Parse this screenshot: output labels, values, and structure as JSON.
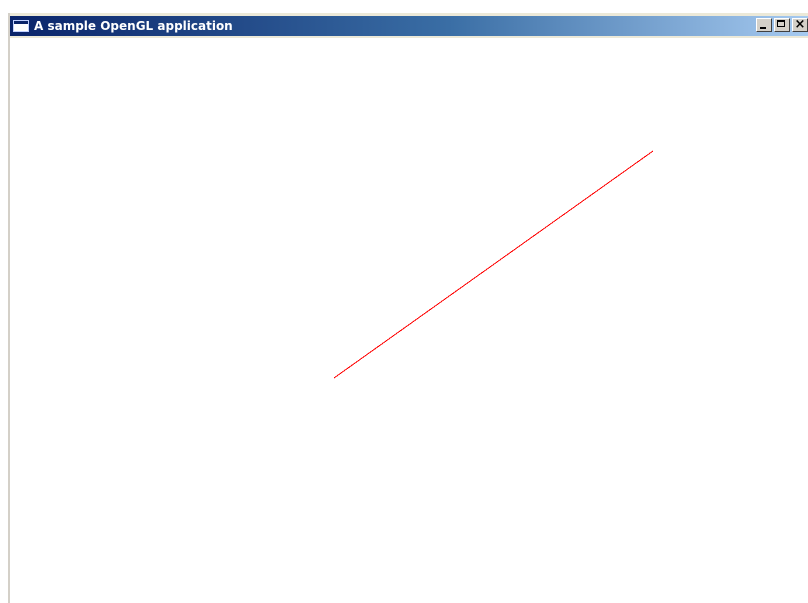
{
  "window": {
    "title": "A sample OpenGL application",
    "icon": "window-app-icon"
  },
  "controls": {
    "minimize_icon": "minimize-icon",
    "maximize_icon": "maximize-icon",
    "close_label": "×"
  },
  "canvas": {
    "background": "#ffffff",
    "line_color": "#ff0000"
  }
}
